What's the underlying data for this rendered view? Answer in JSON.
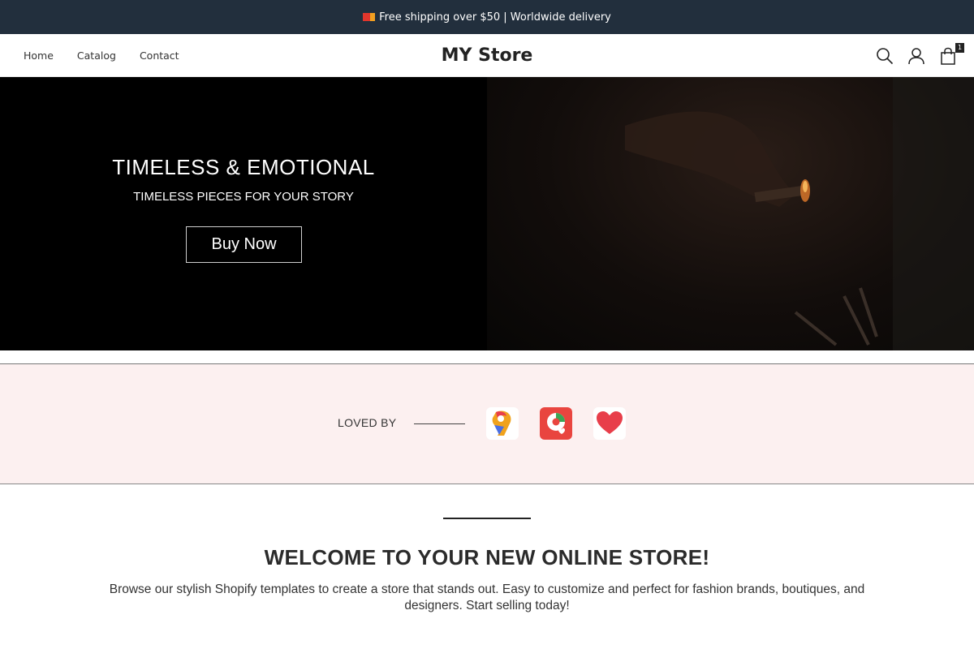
{
  "announcement": {
    "text": "Free shipping over $50 | Worldwide delivery",
    "flag_colors": [
      "#e2362c",
      "#f1a021"
    ]
  },
  "header": {
    "nav": [
      {
        "label": "Home"
      },
      {
        "label": "Catalog"
      },
      {
        "label": "Contact"
      }
    ],
    "brand": "MY Store",
    "cart_count": "1",
    "icons": [
      "search-icon",
      "account-icon",
      "cart-icon"
    ]
  },
  "hero": {
    "title": "TIMELESS & EMOTIONAL",
    "subtitle": "TIMELESS PIECES FOR YOUR STORY",
    "button_label": "Buy Now"
  },
  "loved_by": {
    "label": "LOVED BY",
    "logos": [
      "ranking-9-logo",
      "pin-heart-logo",
      "heart-logo"
    ],
    "accent_colors": [
      "#e83e4a",
      "#e9453f"
    ]
  },
  "welcome": {
    "title": "WELCOME TO YOUR NEW ONLINE STORE!",
    "body": "Browse our stylish Shopify templates to create a store that stands out. Easy to customize and perfect for fashion brands, boutiques, and designers. Start selling today!"
  }
}
